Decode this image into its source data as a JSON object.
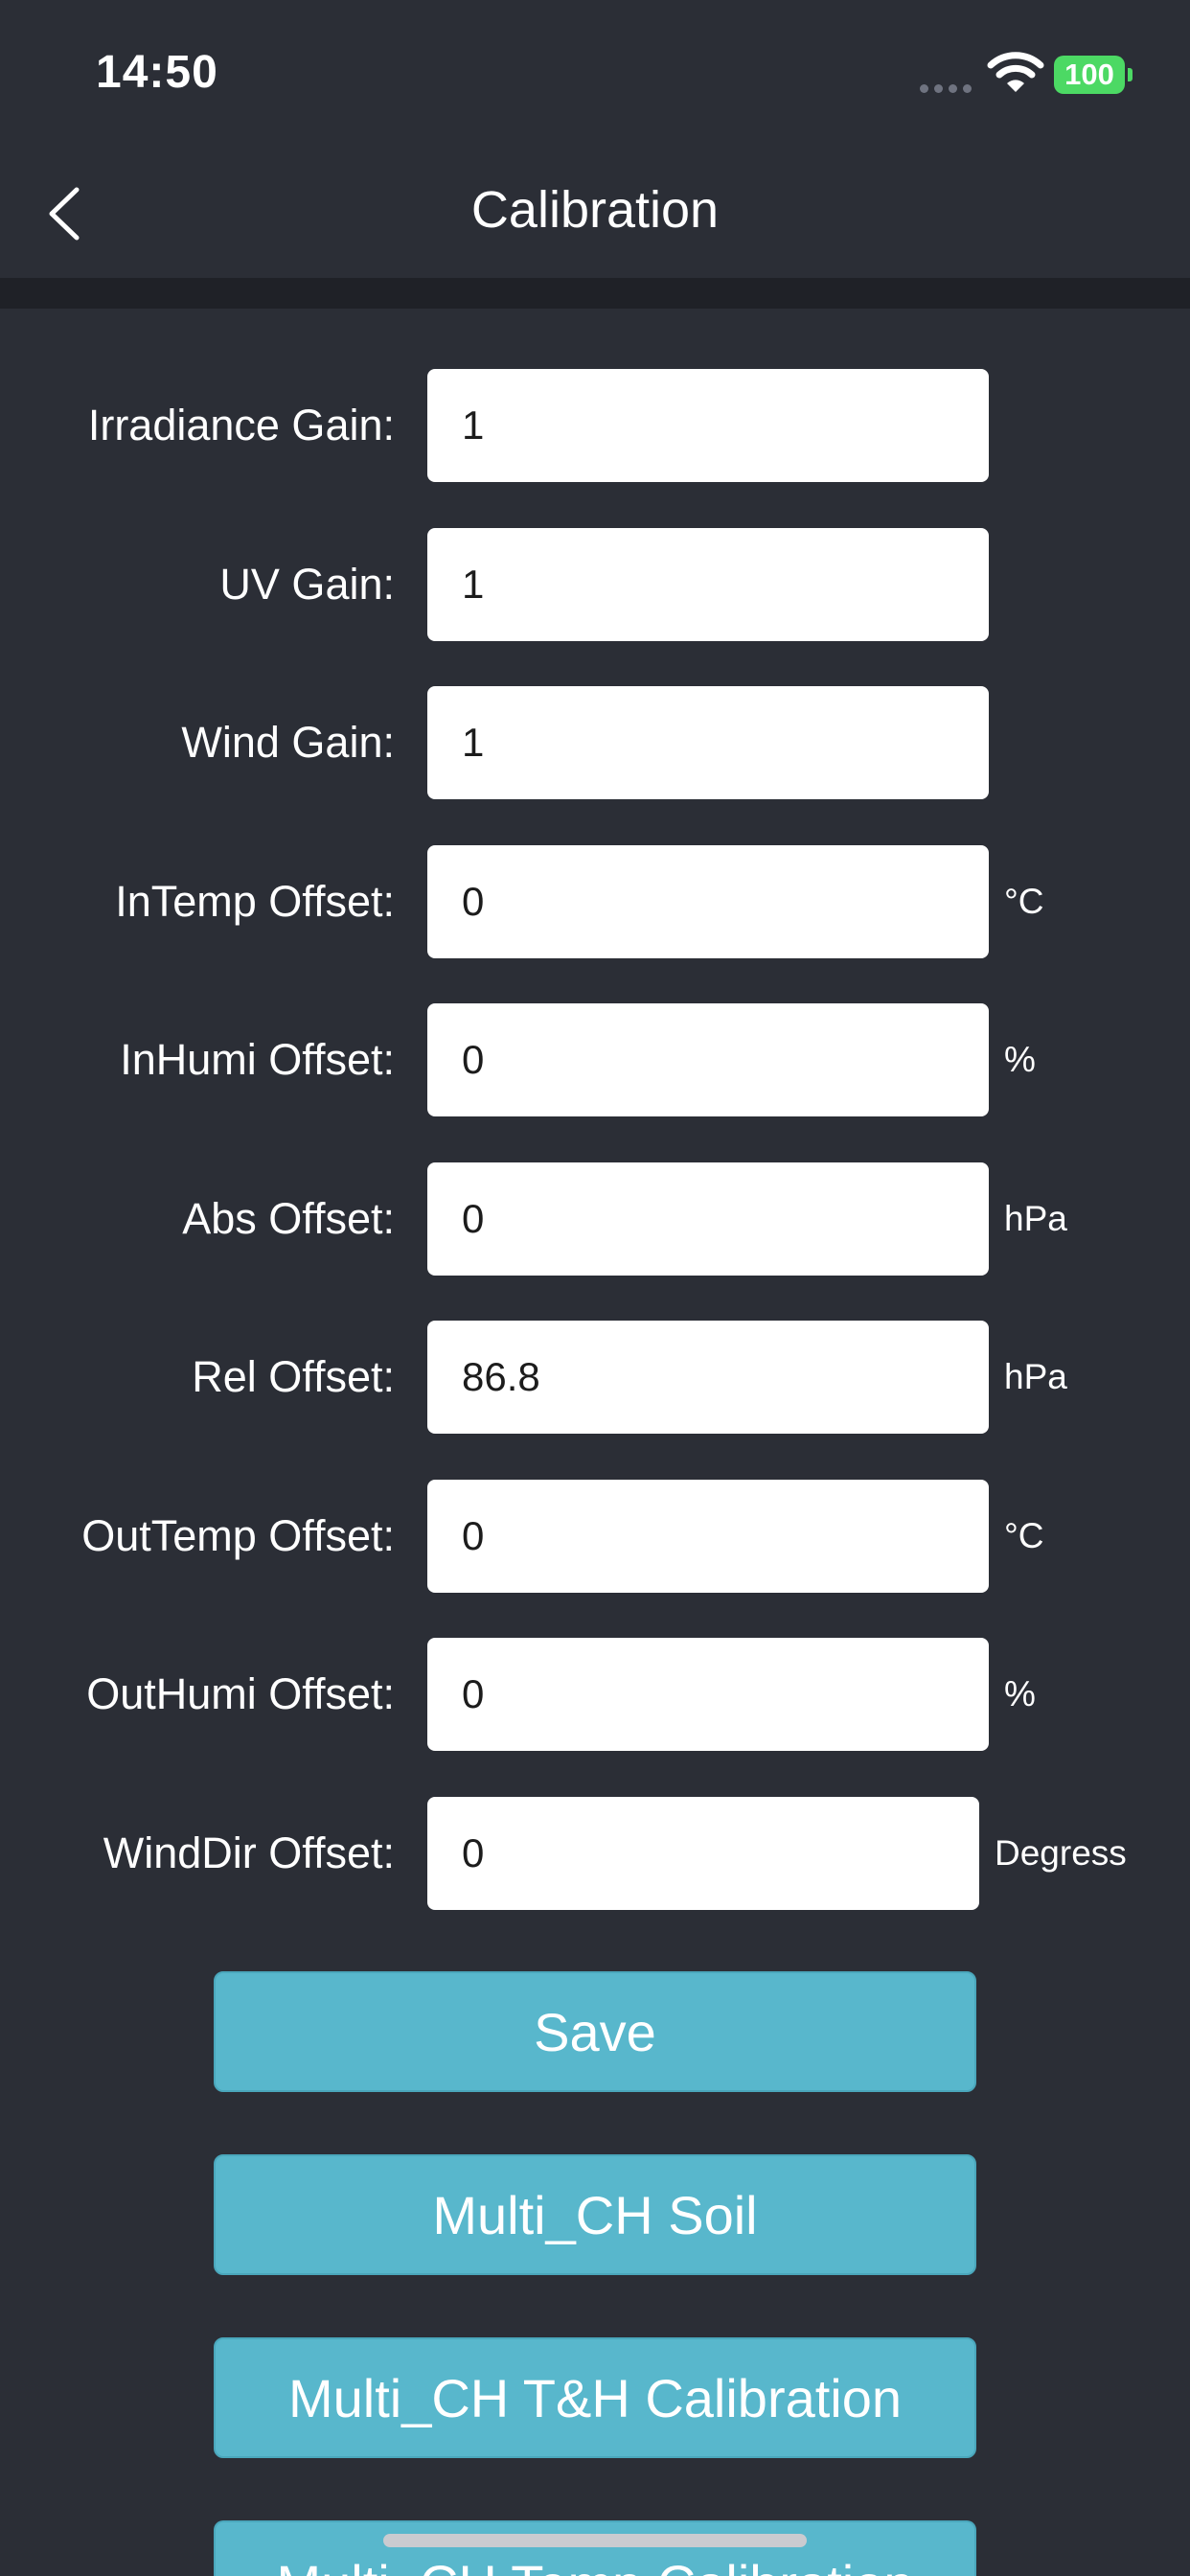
{
  "status_bar": {
    "time": "14:50",
    "battery": "100",
    "icons": [
      "signal-dots-icon",
      "wifi-icon",
      "battery-icon"
    ]
  },
  "header": {
    "title": "Calibration",
    "back_icon": "chevron-left-icon"
  },
  "fields": [
    {
      "label": "Irradiance Gain:",
      "value": "1",
      "unit": ""
    },
    {
      "label": "UV Gain:",
      "value": "1",
      "unit": ""
    },
    {
      "label": "Wind Gain:",
      "value": "1",
      "unit": ""
    },
    {
      "label": "InTemp Offset:",
      "value": "0",
      "unit": "°C"
    },
    {
      "label": "InHumi Offset:",
      "value": "0",
      "unit": "%"
    },
    {
      "label": "Abs Offset:",
      "value": "0",
      "unit": "hPa"
    },
    {
      "label": "Rel Offset:",
      "value": "86.8",
      "unit": "hPa"
    },
    {
      "label": "OutTemp Offset:",
      "value": "0",
      "unit": "°C"
    },
    {
      "label": "OutHumi Offset:",
      "value": "0",
      "unit": "%"
    },
    {
      "label": "WindDir Offset:",
      "value": "0",
      "unit": "Degress"
    }
  ],
  "buttons": {
    "save": "Save",
    "multi_ch_soil": "Multi_CH Soil",
    "multi_ch_th_calibration": "Multi_CH T&H Calibration",
    "multi_ch_temp_calibration": "Multi_CH Temp Calibration"
  },
  "colors": {
    "background": "#2b2e36",
    "accent_button": "#58b7cc",
    "battery": "#4cd964"
  }
}
